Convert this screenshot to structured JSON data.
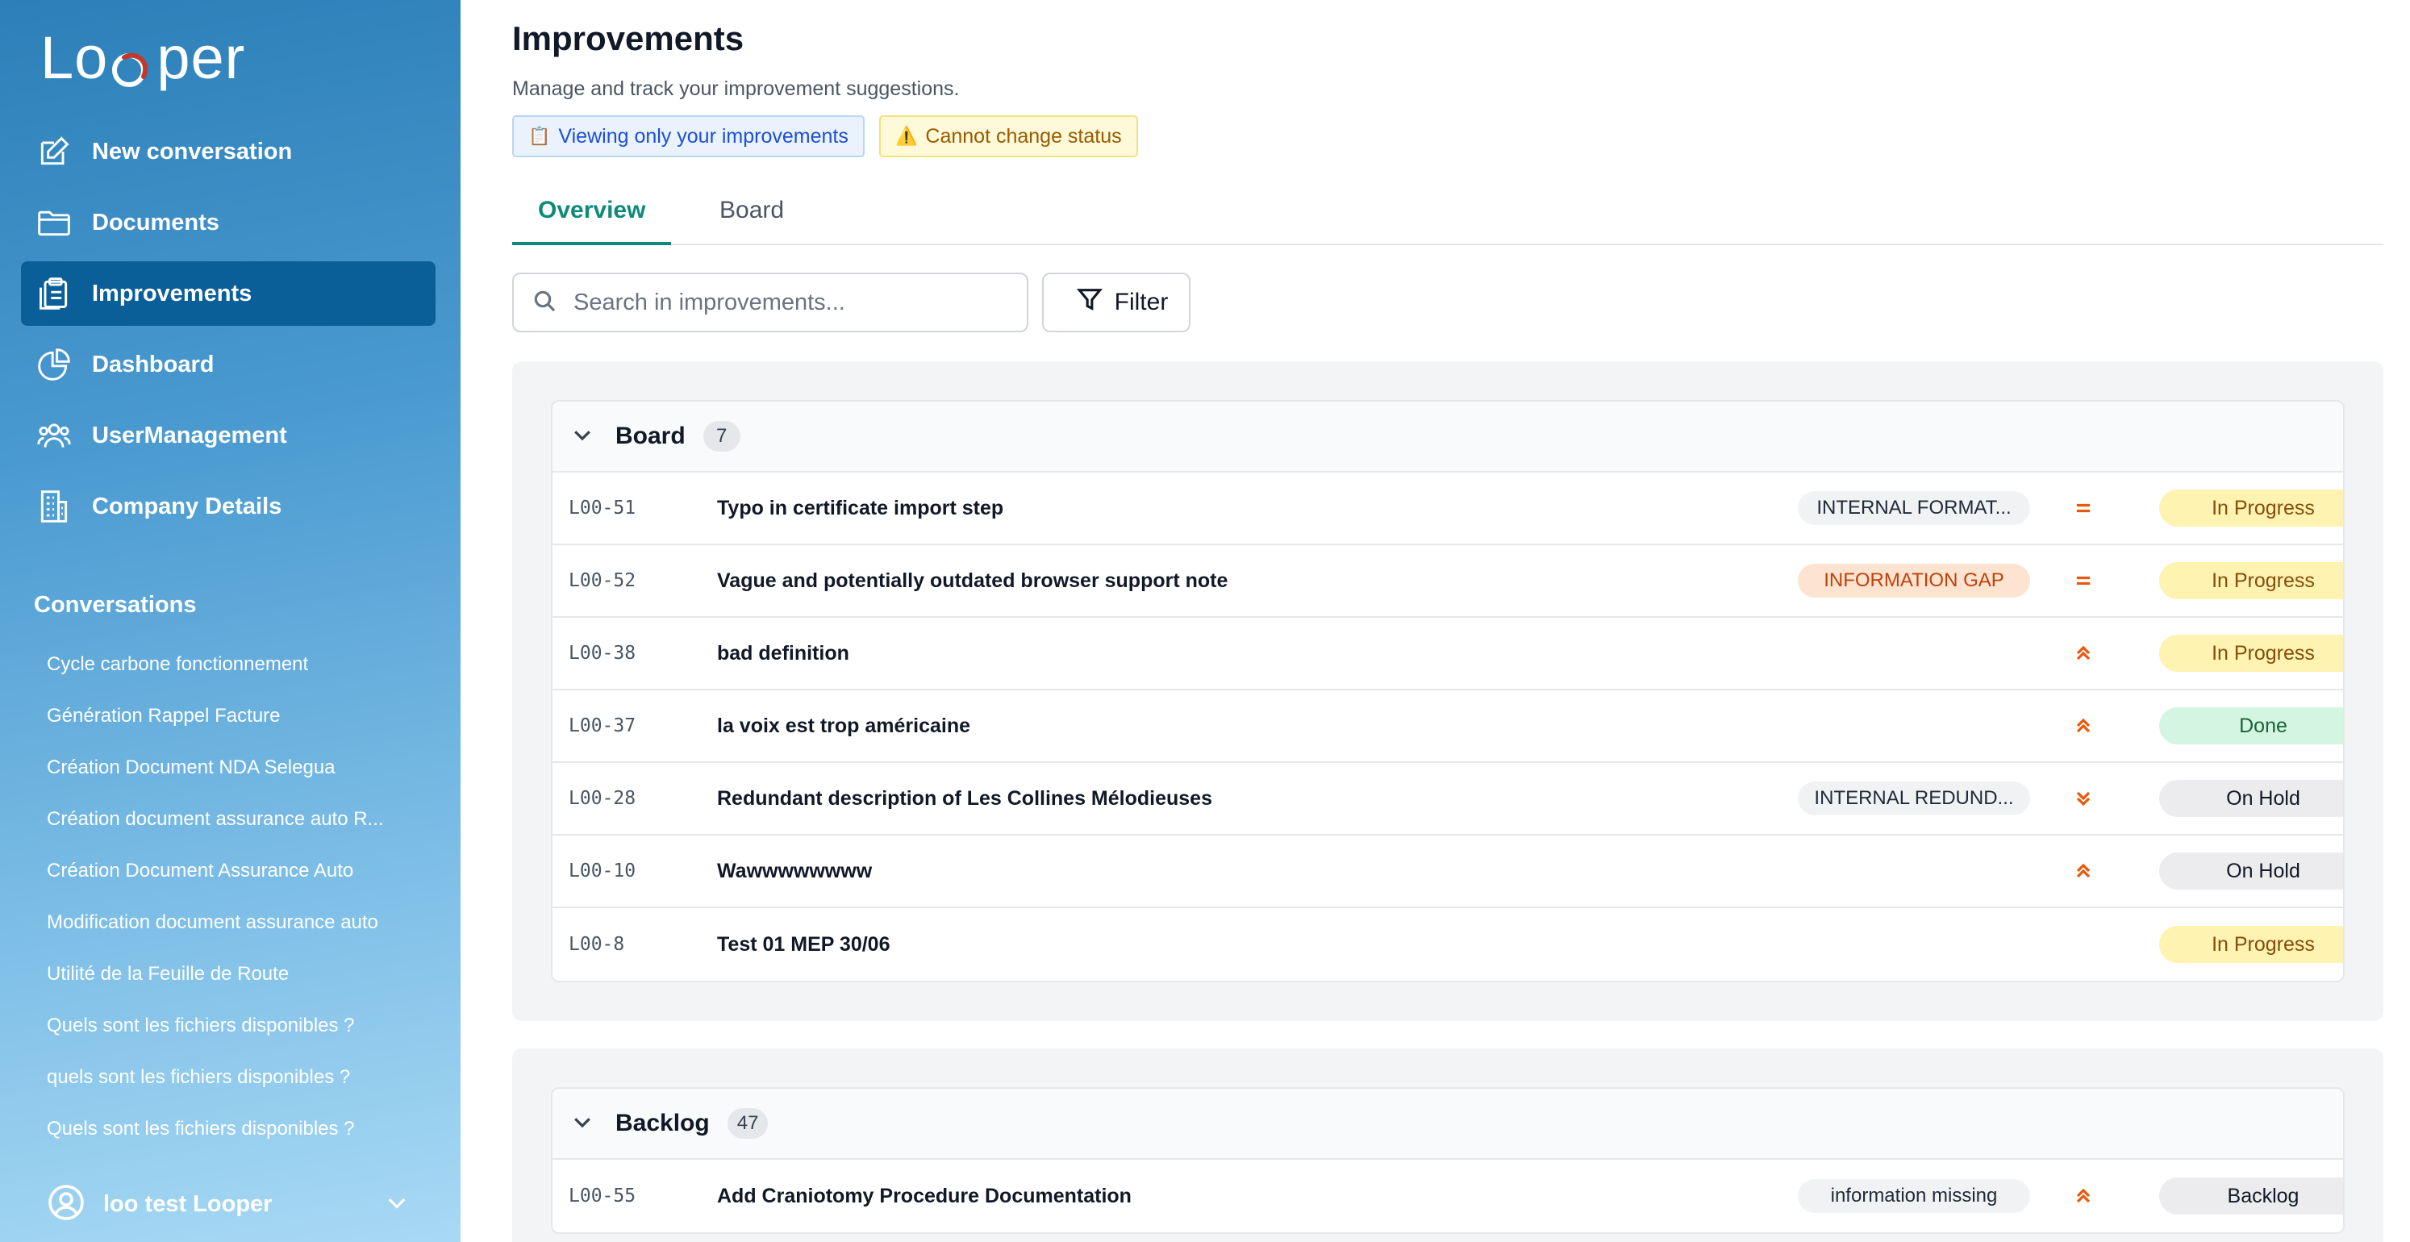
{
  "app": {
    "logo_text_left": "Lo",
    "logo_text_right": "per"
  },
  "sidebar": {
    "nav": [
      {
        "label": "New conversation",
        "icon": "pencil-square-icon"
      },
      {
        "label": "Documents",
        "icon": "folder-icon"
      },
      {
        "label": "Improvements",
        "icon": "clipboard-icon",
        "active": true
      },
      {
        "label": "Dashboard",
        "icon": "pie-chart-icon"
      },
      {
        "label": "UserManagement",
        "icon": "users-icon"
      },
      {
        "label": "Company Details",
        "icon": "building-icon"
      }
    ],
    "conversations_title": "Conversations",
    "conversations": [
      "Cycle carbone fonctionnement",
      "Génération Rappel Facture",
      "Création Document NDA Selegua",
      "Création document assurance auto R...",
      "Création Document Assurance Auto",
      "Modification document assurance auto",
      "Utilité de la Feuille de Route",
      "Quels sont les fichiers disponibles ?",
      "quels sont les fichiers disponibles ?",
      "Quels sont les fichiers disponibles ?"
    ],
    "user": {
      "name": "loo test Looper",
      "icon": "user-circle-icon"
    }
  },
  "page": {
    "title": "Improvements",
    "subtitle": "Manage and track your improvement suggestions.",
    "notice_blue": {
      "glyph": "📋",
      "text": "Viewing only your improvements"
    },
    "notice_yellow": {
      "glyph": "⚠️",
      "text": "Cannot change status"
    },
    "tabs": [
      "Overview",
      "Board"
    ],
    "active_tab": "Overview",
    "search": {
      "placeholder": "Search in improvements...",
      "value": ""
    },
    "filter_label": "Filter"
  },
  "colors": {
    "accent": "#0f8a7a",
    "sidebar_active": "#0b5f98",
    "priority": "#ea580c"
  },
  "groups": [
    {
      "name": "Board",
      "count": "7",
      "rows": [
        {
          "id": "L00-51",
          "title": "Typo in certificate import step",
          "tag": "INTERNAL FORMAT...",
          "tag_style": "gray",
          "priority": "medium",
          "status": "In Progress",
          "status_style": "progress"
        },
        {
          "id": "L00-52",
          "title": "Vague and potentially outdated browser support note",
          "tag": "INFORMATION GAP",
          "tag_style": "orange",
          "priority": "medium",
          "status": "In Progress",
          "status_style": "progress"
        },
        {
          "id": "L00-38",
          "title": "bad definition",
          "tag": "",
          "tag_style": "",
          "priority": "high",
          "status": "In Progress",
          "status_style": "progress"
        },
        {
          "id": "L00-37",
          "title": "la voix est trop américaine",
          "tag": "",
          "tag_style": "",
          "priority": "high",
          "status": "Done",
          "status_style": "done"
        },
        {
          "id": "L00-28",
          "title": "Redundant description of Les Collines Mélodieuses",
          "tag": "INTERNAL REDUND...",
          "tag_style": "gray",
          "priority": "low",
          "status": "On Hold",
          "status_style": "hold"
        },
        {
          "id": "L00-10",
          "title": "Wawwwwwwww",
          "tag": "",
          "tag_style": "",
          "priority": "high",
          "status": "On Hold",
          "status_style": "hold"
        },
        {
          "id": "L00-8",
          "title": "Test 01 MEP 30/06",
          "tag": "",
          "tag_style": "",
          "priority": "none",
          "status": "In Progress",
          "status_style": "progress"
        }
      ]
    },
    {
      "name": "Backlog",
      "count": "47",
      "rows": [
        {
          "id": "L00-55",
          "title": "Add Craniotomy Procedure Documentation",
          "tag": "information missing",
          "tag_style": "gray",
          "priority": "high",
          "status": "Backlog",
          "status_style": "backlog"
        }
      ]
    }
  ]
}
